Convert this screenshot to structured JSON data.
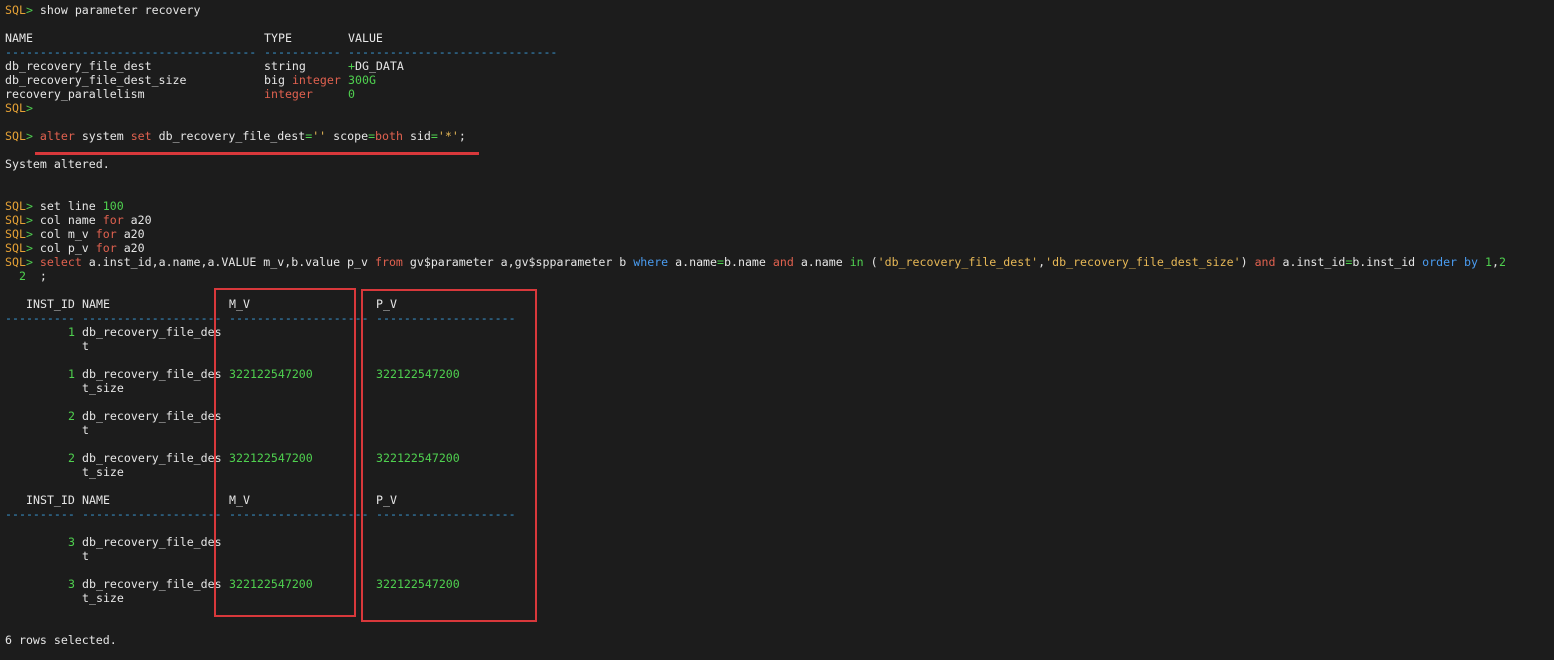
{
  "prompt": "SQL",
  "prompt_sym": ">",
  "cmd1": "show parameter recovery",
  "param_headers": {
    "name": "NAME",
    "type": "TYPE",
    "value": "VALUE"
  },
  "param_dashes": {
    "name": "------------------------------------",
    "type": "-----------",
    "value": "------------------------------"
  },
  "param_rows": [
    {
      "name": "db_recovery_file_dest",
      "type": "string",
      "type2": "",
      "value_prefix": "+",
      "value": "DG_DATA"
    },
    {
      "name": "db_recovery_file_dest_size",
      "type": "big",
      "type2": "integer",
      "value_prefix": "",
      "value": "300G"
    },
    {
      "name": "recovery_parallelism",
      "type": "",
      "type2": "integer",
      "value_prefix": "",
      "value": "0"
    }
  ],
  "cmd2": {
    "alter": "alter",
    "system": "system",
    "set": "set",
    "param": "db_recovery_file_dest",
    "eq": "=",
    "val": "''",
    "scope": "scope",
    "both": "both",
    "sid": "sid",
    "sidval": "'*'",
    "end": ";"
  },
  "altered_msg": "System altered.",
  "set_cmds": [
    {
      "a": "set line ",
      "num": "100",
      "kw": "",
      "b": ""
    },
    {
      "a": "col name ",
      "num": "",
      "kw": "for",
      "b": " a20"
    },
    {
      "a": "col m_v ",
      "num": "",
      "kw": "for",
      "b": " a20"
    },
    {
      "a": "col p_v ",
      "num": "",
      "kw": "for",
      "b": " a20"
    }
  ],
  "select_cmd": {
    "select": "select",
    "cols": " a.inst_id,a.name,a.VALUE m_v,b.value p_v ",
    "from": "from",
    "tables": " gv$parameter a,gv$spparameter b ",
    "where": "where",
    "c1": " a.name",
    "eq": "=",
    "c2": "b.name ",
    "and": "and",
    "c3": " a.name ",
    "in": "in",
    "lp": " (",
    "s1": "'db_recovery_file_dest'",
    "comma": ",",
    "s2": "'db_recovery_file_dest_size'",
    "rp": ") ",
    "and2": "and",
    "c4": " a.inst_id",
    "eq2": "=",
    "c5": "b.inst_id ",
    "order": "order by",
    "sp": " ",
    "n1": "1",
    "comma2": ",",
    "n2": "2"
  },
  "continuation": {
    "num": "2",
    "text": ";"
  },
  "result_headers": {
    "inst_id": "INST_ID",
    "name": "NAME",
    "m_v": "M_V",
    "p_v": "P_V"
  },
  "result_dashes": {
    "inst_id": "----------",
    "name": "--------------------",
    "m_v": "--------------------",
    "p_v": "--------------------"
  },
  "result_rows": [
    {
      "inst_id": "1",
      "name1": "db_recovery_file_des",
      "name2": "t",
      "m_v": "",
      "p_v": ""
    },
    {
      "inst_id": "1",
      "name1": "db_recovery_file_des",
      "name2": "t_size",
      "m_v": "322122547200",
      "p_v": "322122547200"
    },
    {
      "inst_id": "2",
      "name1": "db_recovery_file_des",
      "name2": "t",
      "m_v": "",
      "p_v": ""
    },
    {
      "inst_id": "2",
      "name1": "db_recovery_file_des",
      "name2": "t_size",
      "m_v": "322122547200",
      "p_v": "322122547200"
    },
    {
      "inst_id": "3",
      "name1": "db_recovery_file_des",
      "name2": "t",
      "m_v": "",
      "p_v": ""
    },
    {
      "inst_id": "3",
      "name1": "db_recovery_file_des",
      "name2": "t_size",
      "m_v": "322122547200",
      "p_v": "322122547200"
    }
  ],
  "footer": "6 rows selected.",
  "colors": {
    "highlight": "#d8383b",
    "background": "#1c1c1c"
  }
}
